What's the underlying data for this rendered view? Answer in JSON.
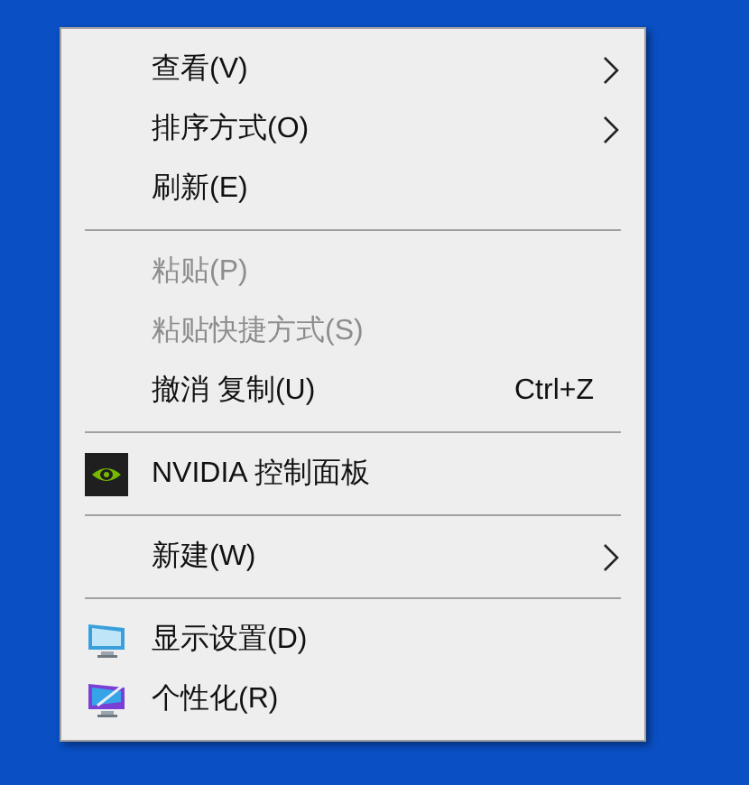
{
  "menu": {
    "groups": [
      {
        "items": [
          {
            "kind": "text",
            "label": "查看(V)",
            "disabled": false,
            "submenu": true
          },
          {
            "kind": "text",
            "label": "排序方式(O)",
            "disabled": false,
            "submenu": true
          },
          {
            "kind": "text",
            "label": "刷新(E)",
            "disabled": false,
            "submenu": false
          }
        ]
      },
      {
        "items": [
          {
            "kind": "text",
            "label": "粘贴(P)",
            "disabled": true,
            "submenu": false
          },
          {
            "kind": "text",
            "label": "粘贴快捷方式(S)",
            "disabled": true,
            "submenu": false
          },
          {
            "kind": "text",
            "label": "撤消 复制(U)",
            "disabled": false,
            "submenu": false,
            "shortcut": "Ctrl+Z"
          }
        ]
      },
      {
        "items": [
          {
            "kind": "graphics",
            "label": "NVIDIA 控制面板",
            "disabled": false,
            "submenu": false
          }
        ]
      },
      {
        "items": [
          {
            "kind": "text",
            "label": "新建(W)",
            "disabled": false,
            "submenu": true
          }
        ]
      },
      {
        "items": [
          {
            "kind": "display",
            "label": "显示设置(D)",
            "disabled": false,
            "submenu": false
          },
          {
            "kind": "personalize",
            "label": "个性化(R)",
            "disabled": false,
            "submenu": false
          }
        ]
      }
    ]
  }
}
